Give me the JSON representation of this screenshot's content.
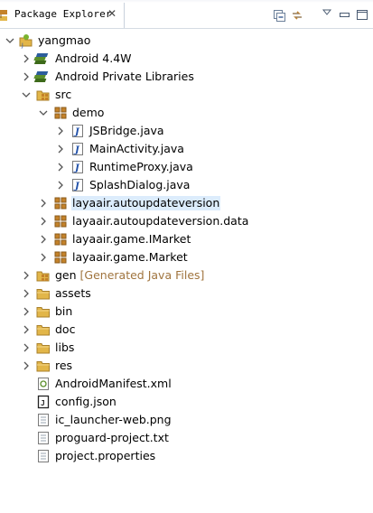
{
  "view": {
    "tab_title": "Package Explorer",
    "toolbar": {
      "collapse_all": "collapse-all-icon",
      "link_with_editor": "link-with-editor-icon",
      "view_menu": "view-menu-icon",
      "minimize": "minimize-icon",
      "maximize": "maximize-icon"
    }
  },
  "tree": {
    "project": "yangmao",
    "android_lib": "Android 4.4W",
    "private_libs": "Android Private Libraries",
    "src": "src",
    "demo": "demo",
    "files_demo": [
      "JSBridge.java",
      "MainActivity.java",
      "RuntimeProxy.java",
      "SplashDialog.java"
    ],
    "packages": [
      "layaair.autoupdateversion",
      "layaair.autoupdateversion.data",
      "layaair.game.IMarket",
      "layaair.game.Market"
    ],
    "gen": "gen",
    "gen_note": "[Generated Java Files]",
    "folders": [
      "assets",
      "bin",
      "doc",
      "libs",
      "res"
    ],
    "files_root": [
      "AndroidManifest.xml",
      "config.json",
      "ic_launcher-web.png",
      "proguard-project.txt",
      "project.properties"
    ],
    "selected": "layaair.autoupdateversion"
  },
  "colors": {
    "package": "#c4822a",
    "folder": "#e2b649",
    "java": "#1f4fa8",
    "android": "#5a8e2a",
    "selection": "#dcecfc"
  }
}
